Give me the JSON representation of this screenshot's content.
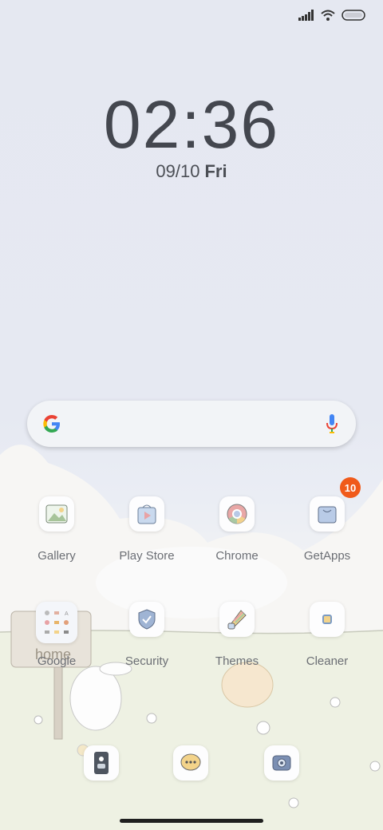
{
  "status_bar": {
    "signal_icon": "signal-icon",
    "wifi_icon": "wifi-icon",
    "battery_icon": "battery-icon"
  },
  "lock": {
    "time": "02:36",
    "date": "09/10",
    "weekday": "Fri"
  },
  "search_bar": {
    "google_logo": "google-g-icon",
    "mic_icon": "microphone-icon"
  },
  "apps_row1": [
    {
      "label": "Gallery",
      "icon": "gallery-icon"
    },
    {
      "label": "Play Store",
      "icon": "play-store-icon"
    },
    {
      "label": "Chrome",
      "icon": "chrome-icon"
    },
    {
      "label": "GetApps",
      "icon": "getapps-icon",
      "badge": "10"
    }
  ],
  "apps_row2": [
    {
      "label": "Google",
      "icon": "google-folder-icon"
    },
    {
      "label": "Security",
      "icon": "security-icon"
    },
    {
      "label": "Themes",
      "icon": "themes-icon"
    },
    {
      "label": "Cleaner",
      "icon": "cleaner-icon"
    }
  ],
  "dock": [
    {
      "icon": "phone-icon"
    },
    {
      "icon": "messages-icon"
    },
    {
      "icon": "camera-icon"
    }
  ],
  "wallpaper_text": "home",
  "colors": {
    "badge": "#f05a1a",
    "text": "#44474f"
  }
}
